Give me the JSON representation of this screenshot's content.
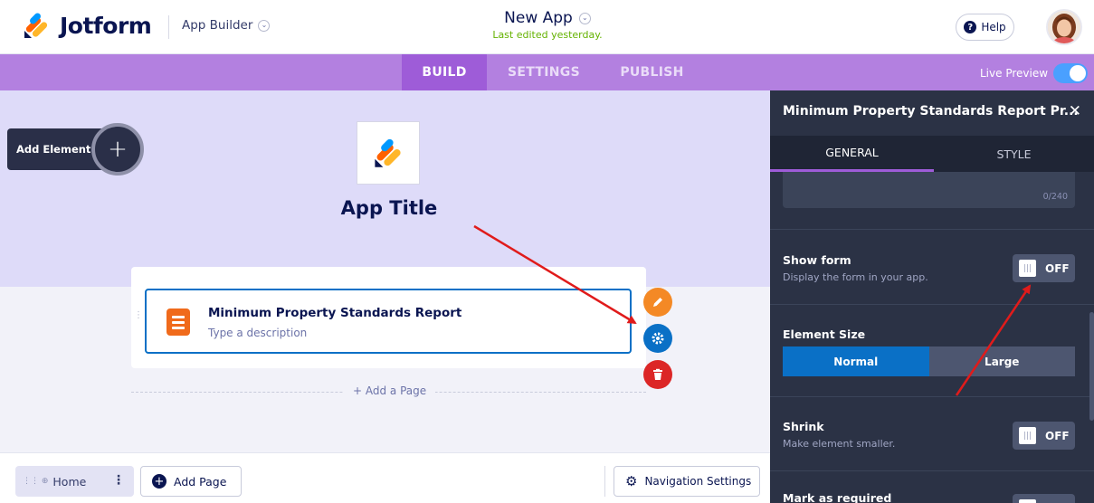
{
  "header": {
    "brand": "Jotform",
    "section_label": "App Builder",
    "app_name": "New App",
    "last_edited": "Last edited yesterday.",
    "help_label": "Help"
  },
  "nav": {
    "tabs": [
      "BUILD",
      "SETTINGS",
      "PUBLISH"
    ],
    "active_tab": "BUILD",
    "live_preview_label": "Live Preview",
    "live_preview_on": true
  },
  "canvas": {
    "add_element_label": "Add Element",
    "app_title": "App Title",
    "form_card": {
      "title": "Minimum Property Standards Report",
      "description_placeholder": "Type a description"
    },
    "add_a_page_label": "+ Add a Page"
  },
  "bottom_bar": {
    "home_label": "Home",
    "add_page_label": "Add Page",
    "navigation_settings_label": "Navigation Settings"
  },
  "panel": {
    "title": "Minimum Property Standards Report Pr...",
    "tabs": [
      "GENERAL",
      "STYLE"
    ],
    "active_tab": "GENERAL",
    "description_counter": "0/240",
    "show_form": {
      "label": "Show form",
      "sublabel": "Display the form in your app.",
      "state": "OFF"
    },
    "element_size": {
      "label": "Element Size",
      "options": [
        "Normal",
        "Large"
      ],
      "selected": "Normal"
    },
    "shrink": {
      "label": "Shrink",
      "sublabel": "Make element smaller.",
      "state": "OFF"
    },
    "mark_required": {
      "label": "Mark as required"
    }
  },
  "colors": {
    "nav_purple": "#b380e0",
    "nav_active": "#9e5cd8",
    "panel_bg": "#2b3245",
    "accent_blue": "#0a70c6",
    "edit_orange": "#f48925",
    "delete_red": "#dc2626",
    "annotation_red": "#e01b1b"
  }
}
